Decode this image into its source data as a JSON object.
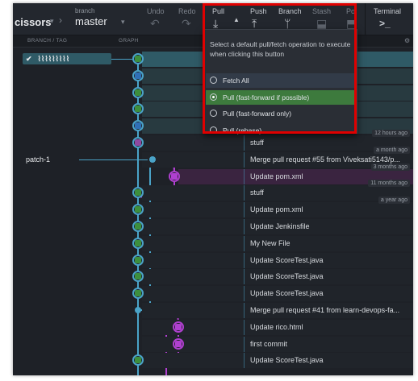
{
  "toolbar": {
    "repo": "cissors",
    "branch_label": "branch",
    "branch": "master",
    "undo": "Undo",
    "redo": "Redo",
    "pull": "Pull",
    "push": "Push",
    "branch_btn": "Branch",
    "stash": "Stash",
    "pop": "Po",
    "terminal": "Terminal",
    "terminal_icon": ">_"
  },
  "columns": {
    "branch_tag": "BRANCH / TAG",
    "graph": "GRAPH"
  },
  "branches": [
    {
      "label": "✔  ⌇⌇⌇⌇⌇⌇⌇⌇⌇",
      "row": 0
    },
    {
      "label": "patch-1",
      "row": 6
    }
  ],
  "commits": [
    {
      "message": ""
    },
    {
      "message": ""
    },
    {
      "message": ""
    },
    {
      "message": ""
    },
    {
      "message": ""
    },
    {
      "message": "stuff",
      "time": "12 hours ago"
    },
    {
      "message": "Merge pull request #55 from Viveksati5143/p...",
      "time": "a month ago"
    },
    {
      "message": "Update pom.xml",
      "time": "3 months ago"
    },
    {
      "message": "stuff",
      "time": "11 months ago"
    },
    {
      "message": "Update pom.xml",
      "time": "a year ago"
    },
    {
      "message": "Update Jenkinsfile"
    },
    {
      "message": "My New File"
    },
    {
      "message": "Update ScoreTest.java"
    },
    {
      "message": "Update ScoreTest.java"
    },
    {
      "message": "Update ScoreTest.java"
    },
    {
      "message": "Merge pull request #41 from learn-devops-fa..."
    },
    {
      "message": "Update rico.html"
    },
    {
      "message": "first commit"
    },
    {
      "message": "Update ScoreTest.java"
    }
  ],
  "popup": {
    "description": "Select a default pull/fetch operation to execute when clicking this button",
    "options": [
      {
        "label": "Fetch All",
        "selected": false
      },
      {
        "label": "Pull (fast-forward if possible)",
        "selected": true
      },
      {
        "label": "Pull (fast-forward only)",
        "selected": false
      },
      {
        "label": "Pull (rebase)",
        "selected": false
      }
    ]
  },
  "colors": {
    "main_line": "#4aa3c8",
    "merge_line": "#b040d0",
    "selected": "#3d7a3d",
    "highlight": "#e00000"
  }
}
